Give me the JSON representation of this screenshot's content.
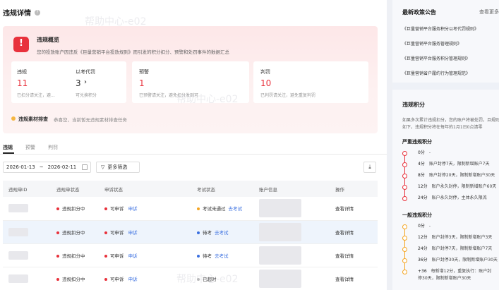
{
  "header": {
    "title": "违规详情"
  },
  "overview": {
    "title": "违规概览",
    "desc": "您的投放账户因违反《巨量营销平台投放规则》而引发的积分扣分、预警和处罚事件的数据汇总",
    "cards": [
      {
        "label": "违规",
        "value": "11",
        "sub": "已扣分请关注，避..."
      },
      {
        "label": "以考代罚",
        "value": "3",
        "arrow": "›",
        "sub": "可兑换积分"
      },
      {
        "label": "预警",
        "value": "1",
        "sub": "已预警请关注，避免扣分发到可"
      },
      {
        "label": "判罚",
        "value": "10",
        "sub": "已判罚请关注，避免重复判罚"
      }
    ],
    "review": {
      "label": "违规素材排查",
      "text": "恭喜您，当前暂无违规素材排查任务"
    }
  },
  "tabs": [
    "违规",
    "预警",
    "判罚"
  ],
  "filters": {
    "date_start": "2026-01-13",
    "date_sep": "~",
    "date_end": "2026-02-11",
    "more_filters": "更多筛选"
  },
  "table": {
    "headers": [
      "违规单ID",
      "违规单状态",
      "申诉状态",
      "考试状态",
      "账户信息",
      "操作"
    ],
    "rows": [
      {
        "status": "违规扣分中",
        "appeal": "可申诉",
        "appeal_link": "申诉",
        "exam": "考试未通过",
        "exam_color": "#f5a623",
        "exam_link": "去考试",
        "action": "查看详情"
      },
      {
        "status": "违规扣分中",
        "appeal": "可申诉",
        "appeal_link": "申诉",
        "exam": "待考",
        "exam_color": "#3a6fe0",
        "exam_link": "去考试",
        "action": "查看详情"
      },
      {
        "status": "违规扣分中",
        "appeal": "可申诉",
        "appeal_link": "申诉",
        "exam": "待考",
        "exam_color": "#3a6fe0",
        "exam_link": "去考试",
        "action": "查看详情"
      },
      {
        "status": "违规扣分中",
        "appeal": "可申诉",
        "appeal_link": "申诉",
        "exam": "已超时",
        "exam_color": "#bbbbbb",
        "exam_link": "",
        "action": "查看详情"
      }
    ]
  },
  "sidebar": {
    "policy_title": "最新政策公告",
    "policy_more": "查看更多",
    "notices": [
      "《巨量营销平台服务积分以考代罚规则》",
      "《巨量营销平台服务管理规则》",
      "《巨量营销平台服务积分管理规则》",
      "《巨量营销省户履约行为管理规范》"
    ],
    "points_title": "违规积分",
    "points_desc": "如果多次累计违规扣分，您的账户将被处罚，且规则如下，违规积分将在每年的1月1日0点清零",
    "severe_title": "严重违规积分",
    "severe": [
      {
        "pts": "0分",
        "text": "-"
      },
      {
        "pts": "4分",
        "text": "账户封停7天，限制新增账户7天"
      },
      {
        "pts": "8分",
        "text": "账户封停20天，限制新增账户30天"
      },
      {
        "pts": "12分",
        "text": "账户永久封停，限制新增账户60天"
      },
      {
        "pts": "24分",
        "text": "账户永久封停，主体永久限流"
      }
    ],
    "general_title": "一般违规积分",
    "general": [
      {
        "pts": "0分",
        "text": "-"
      },
      {
        "pts": "12分",
        "text": "账户封停3天，限制新增账户3天"
      },
      {
        "pts": "24分",
        "text": "账户封停7天，限制新增账户7天"
      },
      {
        "pts": "36分",
        "text": "账户封停30天，限制新增账户30天"
      },
      {
        "pts": "+36",
        "text": "每新增12分，重复执行：账户封停30天，限制新增账户30天"
      }
    ]
  }
}
